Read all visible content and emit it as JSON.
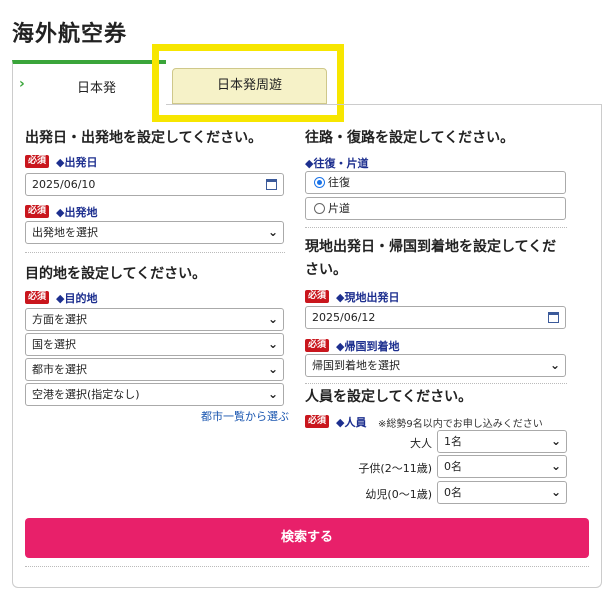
{
  "title": "海外航空券",
  "tabs": [
    {
      "label": "日本発",
      "active": true
    },
    {
      "label": "日本発周遊",
      "active": false
    }
  ],
  "required_badge": "必須",
  "left": {
    "section1_heading": "出発日・出発地を設定してください。",
    "departure_date_label": "◆出発日",
    "departure_date_value": "2025/06/10",
    "departure_place_label": "◆出発地",
    "departure_place_value": "出発地を選択",
    "section2_heading": "目的地を設定してください。",
    "destination_label": "◆目的地",
    "direction_value": "方面を選択",
    "country_value": "国を選択",
    "city_value": "都市を選択",
    "airport_value": "空港を選択(指定なし)",
    "city_list_link": "都市一覧から選ぶ"
  },
  "right": {
    "section1_heading": "往路・復路を設定してください。",
    "trip_type_label": "◆往復・片道",
    "trip_round": "往復",
    "trip_oneway": "片道",
    "trip_selected": "往復",
    "section2_heading_line1": "現地出発日・帰国到着地を設定してくだ",
    "section2_heading_line2": "さい。",
    "local_departure_label": "◆現地出発日",
    "local_departure_value": "2025/06/12",
    "return_arrival_label": "◆帰国到着地",
    "return_arrival_value": "帰国到着地を選択",
    "section3_heading": "人員を設定してください。",
    "passengers_label": "◆人員",
    "passengers_note": "※総勢9名以内でお申し込みください",
    "adult_label": "大人",
    "adult_value": "1名",
    "child_label": "子供(2〜11歳)",
    "child_value": "0名",
    "infant_label": "幼児(0〜1歳)",
    "infant_value": "0名"
  },
  "search_button": "検索する",
  "colors": {
    "accent": "#e8206a",
    "tab_green": "#3aa53a",
    "highlight": "#f7e600",
    "required": "#c9161d"
  }
}
